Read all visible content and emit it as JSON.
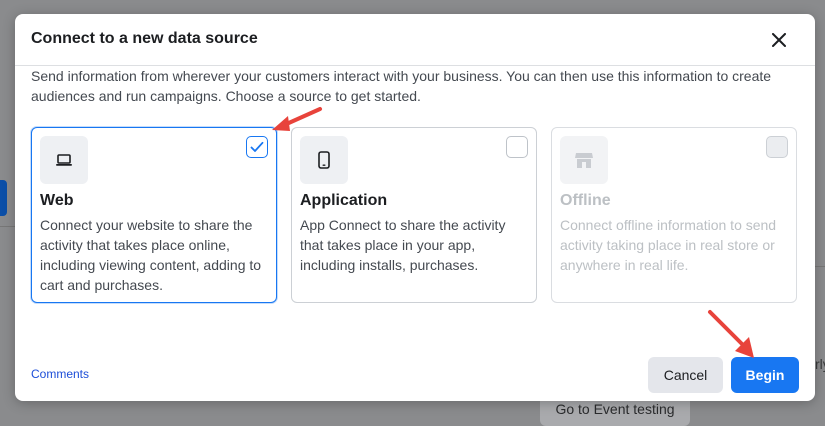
{
  "background": {
    "event_testing_label": "Go to Event testing",
    "right_edge_text": "rly"
  },
  "dialog": {
    "title": "Connect to a new data source",
    "description": "Send information from wherever your customers interact with your business. You can then use this information to create audiences and run campaigns. Choose a source to get started.",
    "close_icon": "close-icon",
    "sources": [
      {
        "title": "Web",
        "description": "Connect your website to share the activity that takes place online, including viewing content, adding to cart and purchases.",
        "icon": "laptop-icon",
        "checked": true,
        "disabled": false
      },
      {
        "title": "Application",
        "description": "App Connect to share the activity that takes place in your app, including installs, purchases.",
        "icon": "mobile-phone-icon",
        "checked": false,
        "disabled": false
      },
      {
        "title": "Offline",
        "description": "Connect offline information to send activity taking place in real store or anywhere in real life.",
        "icon": "storefront-icon",
        "checked": false,
        "disabled": true
      }
    ],
    "footer": {
      "comments_link": "Comments",
      "cancel_label": "Cancel",
      "begin_label": "Begin"
    }
  },
  "colors": {
    "accent": "#1877f2",
    "annotation_arrow": "#e8433b"
  }
}
